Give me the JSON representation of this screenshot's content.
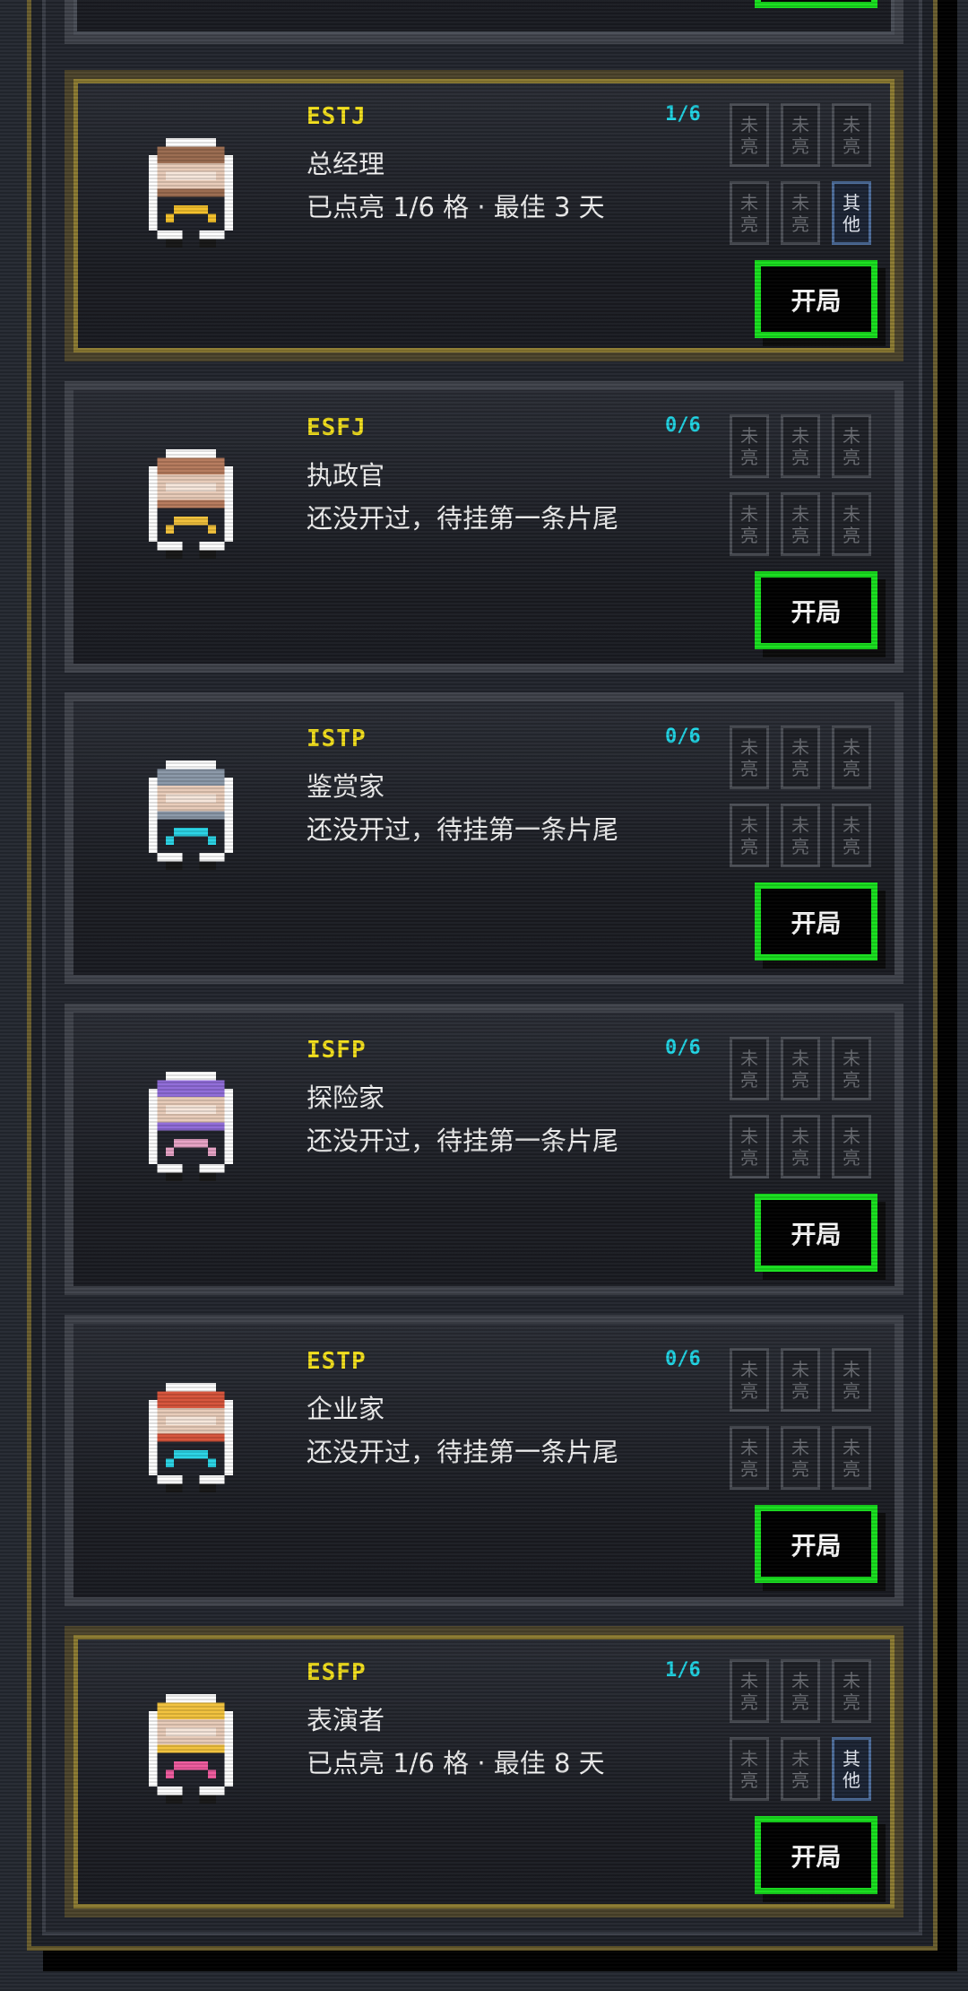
{
  "accent": {
    "highlight_frame": "#8c7b31",
    "start_button_border": "#18e01e",
    "code_color": "#f5e11d",
    "ratio_color": "#20d6e6"
  },
  "cards": [
    {
      "code": "ESTJ",
      "ratio": "1/6",
      "title": "总经理",
      "desc": "已点亮 1/6 格 · 最佳 3 天",
      "cells": [
        "未亮",
        "未亮",
        "未亮",
        "未亮",
        "未亮",
        "其他"
      ],
      "button": "开局",
      "highlighted": true,
      "hair": "#9a6b4f",
      "accent_color": "#f5c12a"
    },
    {
      "code": "ESFJ",
      "ratio": "0/6",
      "title": "执政官",
      "desc": "还没开过，待挂第一条片尾",
      "cells": [
        "未亮",
        "未亮",
        "未亮",
        "未亮",
        "未亮",
        "未亮"
      ],
      "button": "开局",
      "highlighted": false,
      "hair": "#b57a5c",
      "accent_color": "#f2c13a"
    },
    {
      "code": "ISTP",
      "ratio": "0/6",
      "title": "鉴赏家",
      "desc": "还没开过，待挂第一条片尾",
      "cells": [
        "未亮",
        "未亮",
        "未亮",
        "未亮",
        "未亮",
        "未亮"
      ],
      "button": "开局",
      "highlighted": false,
      "hair": "#8a98a8",
      "accent_color": "#29d4e6"
    },
    {
      "code": "ISFP",
      "ratio": "0/6",
      "title": "探险家",
      "desc": "还没开过，待挂第一条片尾",
      "cells": [
        "未亮",
        "未亮",
        "未亮",
        "未亮",
        "未亮",
        "未亮"
      ],
      "button": "开局",
      "highlighted": false,
      "hair": "#8f6bd8",
      "accent_color": "#e7a3c6"
    },
    {
      "code": "ESTP",
      "ratio": "0/6",
      "title": "企业家",
      "desc": "还没开过，待挂第一条片尾",
      "cells": [
        "未亮",
        "未亮",
        "未亮",
        "未亮",
        "未亮",
        "未亮"
      ],
      "button": "开局",
      "highlighted": false,
      "hair": "#d6533a",
      "accent_color": "#29d4e6"
    },
    {
      "code": "ESFP",
      "ratio": "1/6",
      "title": "表演者",
      "desc": "已点亮 1/6 格 · 最佳 8 天",
      "cells": [
        "未亮",
        "未亮",
        "未亮",
        "未亮",
        "未亮",
        "其他"
      ],
      "button": "开局",
      "highlighted": true,
      "hair": "#f2c23c",
      "accent_color": "#f05a9e"
    }
  ]
}
